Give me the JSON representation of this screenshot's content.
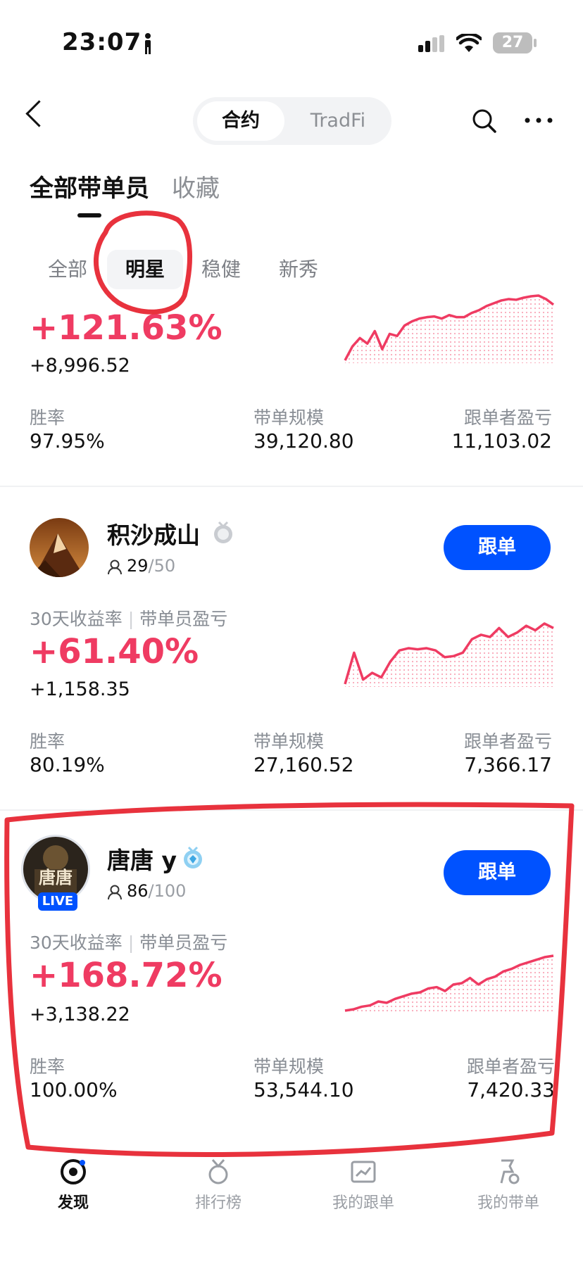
{
  "status_bar": {
    "time": "23:07",
    "battery": "27"
  },
  "header": {
    "seg_active": "合约",
    "seg_inactive": "TradFi"
  },
  "main_tabs": {
    "active": "全部带单员",
    "inactive": "收藏"
  },
  "filter_chips": [
    "全部",
    "明星",
    "稳健",
    "新秀"
  ],
  "cards": [
    {
      "roi": "+121.63%",
      "pnl": "+8,996.52",
      "win_rate_label": "胜率",
      "win_rate": "97.95%",
      "aum_label": "带单规模",
      "aum": "39,120.80",
      "copier_pnl_label": "跟单者盈亏",
      "copier_pnl": "11,103.02",
      "sparkline": [
        20,
        40,
        52,
        44,
        62,
        36,
        58,
        55,
        70,
        76,
        80,
        82,
        83,
        80,
        85,
        82,
        82,
        88,
        92,
        98,
        102,
        106,
        108,
        107,
        110,
        112,
        113,
        108,
        100
      ]
    },
    {
      "name": "积沙成山",
      "followers": "29",
      "followers_max": "/50",
      "follow_label": "跟单",
      "period_label": "30天收益率",
      "pnl_label": "带单员盈亏",
      "roi": "+61.40%",
      "pnl": "+1,158.35",
      "win_rate_label": "胜率",
      "win_rate": "80.19%",
      "aum_label": "带单规模",
      "aum": "27,160.52",
      "copier_pnl_label": "跟单者盈亏",
      "copier_pnl": "7,366.17",
      "sparkline": [
        20,
        48,
        24,
        30,
        26,
        40,
        50,
        52,
        51,
        52,
        50,
        44,
        45,
        48,
        60,
        64,
        62,
        70,
        62,
        66,
        72,
        68,
        74,
        70
      ]
    },
    {
      "name": "唐唐 y",
      "followers": "86",
      "followers_max": "/100",
      "live_label": "LIVE",
      "avatar_text": "唐唐",
      "follow_label": "跟单",
      "period_label": "30天收益率",
      "pnl_label": "带单员盈亏",
      "roi": "+168.72%",
      "pnl": "+3,138.22",
      "win_rate_label": "胜率",
      "win_rate": "100.00%",
      "aum_label": "带单规模",
      "aum": "53,544.10",
      "copier_pnl_label": "跟单者盈亏",
      "copier_pnl": "7,420.33",
      "sparkline": [
        10,
        12,
        16,
        18,
        24,
        22,
        28,
        32,
        36,
        38,
        44,
        46,
        40,
        50,
        52,
        60,
        50,
        58,
        62,
        70,
        74,
        80,
        84,
        88,
        92,
        94
      ]
    }
  ],
  "bottom_nav": [
    "发现",
    "排行榜",
    "我的跟单",
    "我的带单"
  ],
  "colors": {
    "accent": "#0052ff",
    "profit": "#ef3b62",
    "annotation": "#e8323d"
  }
}
